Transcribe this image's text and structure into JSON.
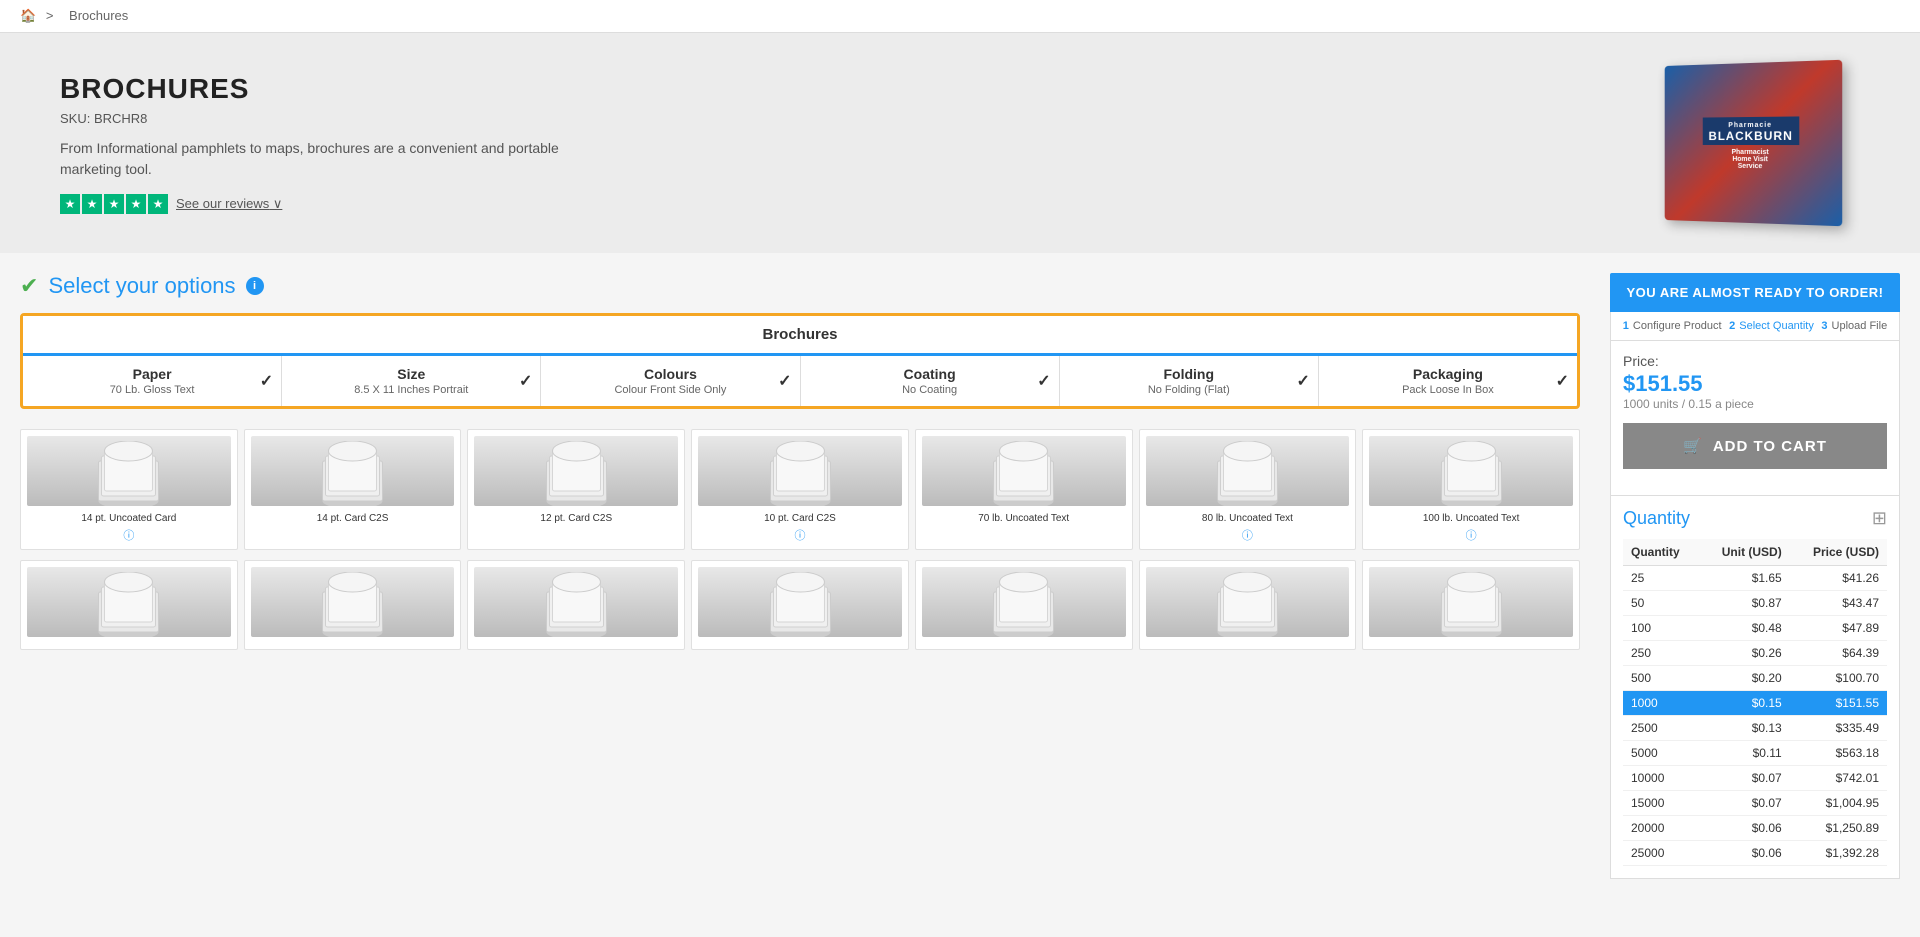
{
  "breadcrumb": {
    "home": "🏠",
    "separator": ">",
    "current": "Brochures"
  },
  "hero": {
    "title": "BROCHURES",
    "sku": "SKU: BRCHR8",
    "description": "From Informational pamphlets to maps, brochures are a convenient and portable marketing tool.",
    "stars": 4.5,
    "reviews_label": "See our reviews",
    "reviews_chevron": "⌄"
  },
  "options_section": {
    "title": "Select your options",
    "info": "i",
    "tab_name": "Brochures",
    "tabs": [
      {
        "name": "Paper",
        "value": "70 Lb. Gloss Text",
        "checked": true
      },
      {
        "name": "Size",
        "value": "8.5 X 11 Inches Portrait",
        "checked": true
      },
      {
        "name": "Colours",
        "value": "Colour Front Side Only",
        "checked": true
      },
      {
        "name": "Coating",
        "value": "No Coating",
        "checked": true
      },
      {
        "name": "Folding",
        "value": "No Folding (Flat)",
        "checked": true
      },
      {
        "name": "Packaging",
        "value": "Pack Loose In Box",
        "checked": true
      }
    ]
  },
  "products_row1": [
    {
      "label": "14 pt. Uncoated Card",
      "has_info": true
    },
    {
      "label": "14 pt. Card C2S",
      "has_info": false
    },
    {
      "label": "12 pt. Card C2S",
      "has_info": false
    },
    {
      "label": "10 pt. Card C2S",
      "has_info": true
    },
    {
      "label": "70 lb. Uncoated Text",
      "has_info": false
    },
    {
      "label": "80 lb. Uncoated Text",
      "has_info": true
    },
    {
      "label": "100 lb. Uncoated Text",
      "has_info": true
    }
  ],
  "products_row2": [
    {
      "label": "",
      "has_info": false
    },
    {
      "label": "",
      "has_info": false
    },
    {
      "label": "",
      "has_info": false
    },
    {
      "label": "",
      "has_info": false
    },
    {
      "label": "",
      "has_info": false
    },
    {
      "label": "",
      "has_info": false
    },
    {
      "label": "",
      "has_info": false
    }
  ],
  "sidebar": {
    "banner": "YOU ARE ALMOST READY TO ORDER!",
    "steps": [
      {
        "num": "1",
        "label": "Configure Product",
        "active": false
      },
      {
        "num": "2",
        "label": "Select Quantity",
        "active": true
      },
      {
        "num": "3",
        "label": "Upload File",
        "active": false
      }
    ],
    "price_label": "Price:",
    "price": "$151.55",
    "price_sub": "1000 units / 0.15 a piece",
    "add_to_cart": "ADD TO CART",
    "cart_icon": "🛒",
    "quantity_title": "Quantity",
    "qty_headers": [
      "Quantity",
      "Unit (USD)",
      "Price (USD)"
    ],
    "qty_rows": [
      {
        "qty": "25",
        "unit": "$1.65",
        "price": "$41.26",
        "selected": false
      },
      {
        "qty": "50",
        "unit": "$0.87",
        "price": "$43.47",
        "selected": false
      },
      {
        "qty": "100",
        "unit": "$0.48",
        "price": "$47.89",
        "selected": false
      },
      {
        "qty": "250",
        "unit": "$0.26",
        "price": "$64.39",
        "selected": false
      },
      {
        "qty": "500",
        "unit": "$0.20",
        "price": "$100.70",
        "selected": false
      },
      {
        "qty": "1000",
        "unit": "$0.15",
        "price": "$151.55",
        "selected": true
      },
      {
        "qty": "2500",
        "unit": "$0.13",
        "price": "$335.49",
        "selected": false
      },
      {
        "qty": "5000",
        "unit": "$0.11",
        "price": "$563.18",
        "selected": false
      },
      {
        "qty": "10000",
        "unit": "$0.07",
        "price": "$742.01",
        "selected": false
      },
      {
        "qty": "15000",
        "unit": "$0.07",
        "price": "$1,004.95",
        "selected": false
      },
      {
        "qty": "20000",
        "unit": "$0.06",
        "price": "$1,250.89",
        "selected": false
      },
      {
        "qty": "25000",
        "unit": "$0.06",
        "price": "$1,392.28",
        "selected": false
      }
    ]
  }
}
